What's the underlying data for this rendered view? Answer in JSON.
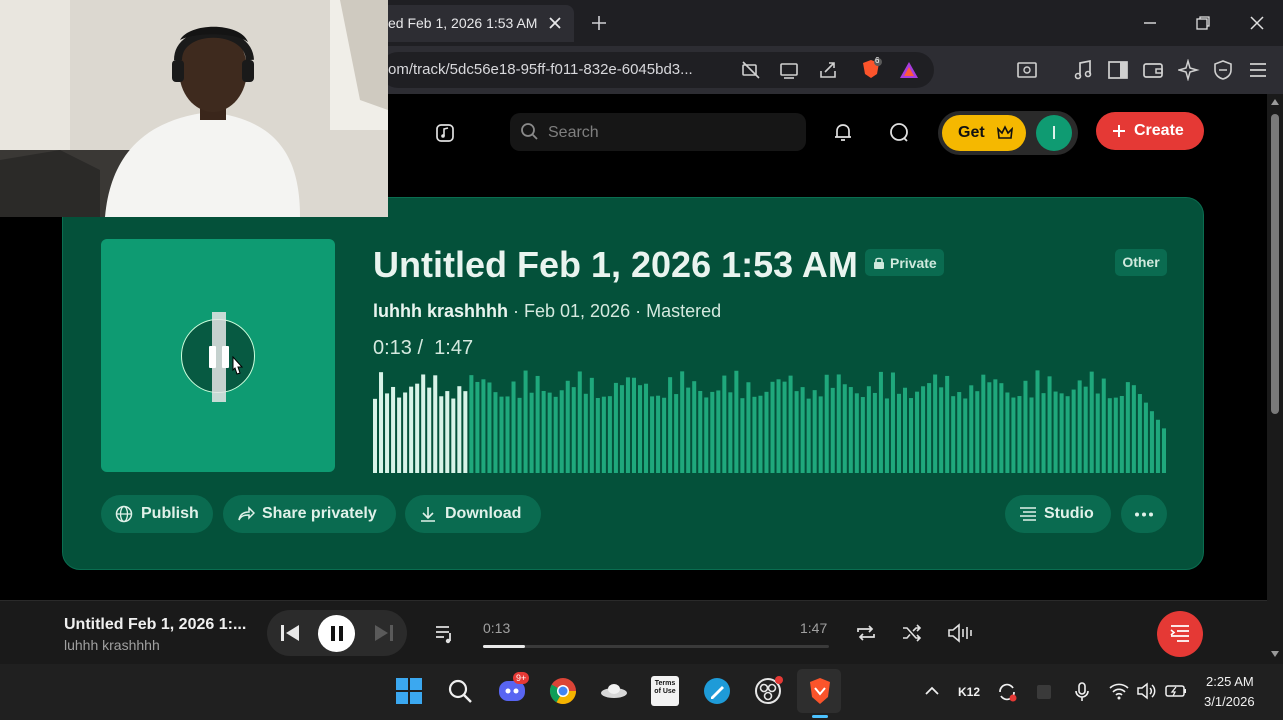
{
  "browser": {
    "tab_title": "ed Feb 1, 2026 1:53 AM",
    "url": "om/track/5dc56e18-95ff-f011-832e-6045bd3...",
    "brave_shield_count": "6"
  },
  "header": {
    "search_placeholder": "Search",
    "get_label": "Get",
    "avatar_initial": "I",
    "create_label": "Create"
  },
  "track": {
    "title": "Untitled Feb 1, 2026 1:53 AM",
    "privacy_label": "Private",
    "genre_label": "Other",
    "artist": "luhhh krashhhh",
    "meta_rest": " · Feb 01, 2026 · Mastered",
    "current_time": "0:13",
    "duration": "1:47",
    "played_fraction": 0.12,
    "buttons": {
      "publish": "Publish",
      "share": "Share privately",
      "download": "Download",
      "studio": "Studio"
    }
  },
  "player": {
    "title": "Untitled Feb 1, 2026 1:...",
    "artist": "luhhh krashhhh",
    "current_time": "0:13",
    "duration": "1:47",
    "progress_fraction": 0.12
  },
  "taskbar": {
    "discord_badge": "9+",
    "terms_label": "Terms of Use",
    "k12_label": "K12",
    "time": "2:25 AM",
    "date": "3/1/2026"
  },
  "colors": {
    "card": "#04513a",
    "accent_green": "#0e9b72",
    "wave_played": "#d8f3e8",
    "wave_unplayed": "#1fa87c",
    "create_red": "#e53935",
    "get_yellow": "#f5b800"
  }
}
